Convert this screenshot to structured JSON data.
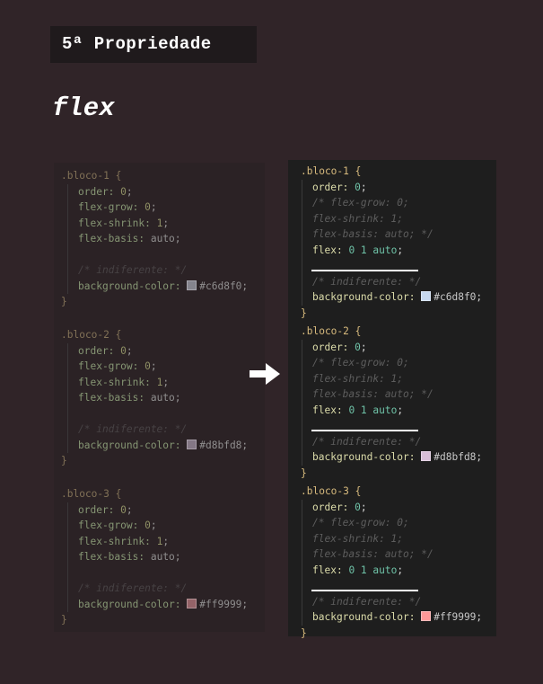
{
  "header": {
    "title": "5ª Propriedade",
    "subtitle": "flex"
  },
  "arrow_icon": "right-arrow-icon",
  "before": [
    {
      "selector": ".bloco-1 {",
      "props": [
        {
          "name": "order:",
          "value": "0"
        },
        {
          "name": "flex-grow:",
          "value": "0"
        },
        {
          "name": "flex-shrink:",
          "value": "1"
        },
        {
          "name": "flex-basis:",
          "value": "auto"
        }
      ],
      "comment": "/* indiferente: */",
      "bg_prop": "background-color:",
      "bg_value": "#c6d8f0",
      "close": "}"
    },
    {
      "selector": ".bloco-2 {",
      "props": [
        {
          "name": "order:",
          "value": "0"
        },
        {
          "name": "flex-grow:",
          "value": "0"
        },
        {
          "name": "flex-shrink:",
          "value": "1"
        },
        {
          "name": "flex-basis:",
          "value": "auto"
        }
      ],
      "comment": "/* indiferente: */",
      "bg_prop": "background-color:",
      "bg_value": "#d8bfd8",
      "close": "}"
    },
    {
      "selector": ".bloco-3 {",
      "props": [
        {
          "name": "order:",
          "value": "0"
        },
        {
          "name": "flex-grow:",
          "value": "0"
        },
        {
          "name": "flex-shrink:",
          "value": "1"
        },
        {
          "name": "flex-basis:",
          "value": "auto"
        }
      ],
      "comment": "/* indiferente: */",
      "bg_prop": "background-color:",
      "bg_value": "#ff9999",
      "close": "}"
    }
  ],
  "after": [
    {
      "selector": ".bloco-1 {",
      "order_name": "order:",
      "order_value": "0",
      "comment_lines": [
        "/* flex-grow: 0;",
        "flex-shrink: 1;",
        "flex-basis: auto; */"
      ],
      "flex_name": "flex:",
      "flex_value": "0 1 auto",
      "comment": "/* indiferente: */",
      "bg_prop": "background-color:",
      "bg_value": "#c6d8f0",
      "close": "}"
    },
    {
      "selector": ".bloco-2 {",
      "order_name": "order:",
      "order_value": "0",
      "comment_lines": [
        "/* flex-grow: 0;",
        "flex-shrink: 1;",
        "flex-basis: auto; */"
      ],
      "flex_name": "flex:",
      "flex_value": "0 1 auto",
      "comment": "/* indiferente: */",
      "bg_prop": "background-color:",
      "bg_value": "#d8bfd8",
      "close": "}"
    },
    {
      "selector": ".bloco-3 {",
      "order_name": "order:",
      "order_value": "0",
      "comment_lines": [
        "/* flex-grow: 0;",
        "flex-shrink: 1;",
        "flex-basis: auto; */"
      ],
      "flex_name": "flex:",
      "flex_value": "0 1 auto",
      "comment": "/* indiferente: */",
      "bg_prop": "background-color:",
      "bg_value": "#ff9999",
      "close": "}"
    }
  ],
  "colors": {
    "background": "#302428",
    "title_box": "#1f1a1c",
    "editor": "#1e1e1e"
  }
}
